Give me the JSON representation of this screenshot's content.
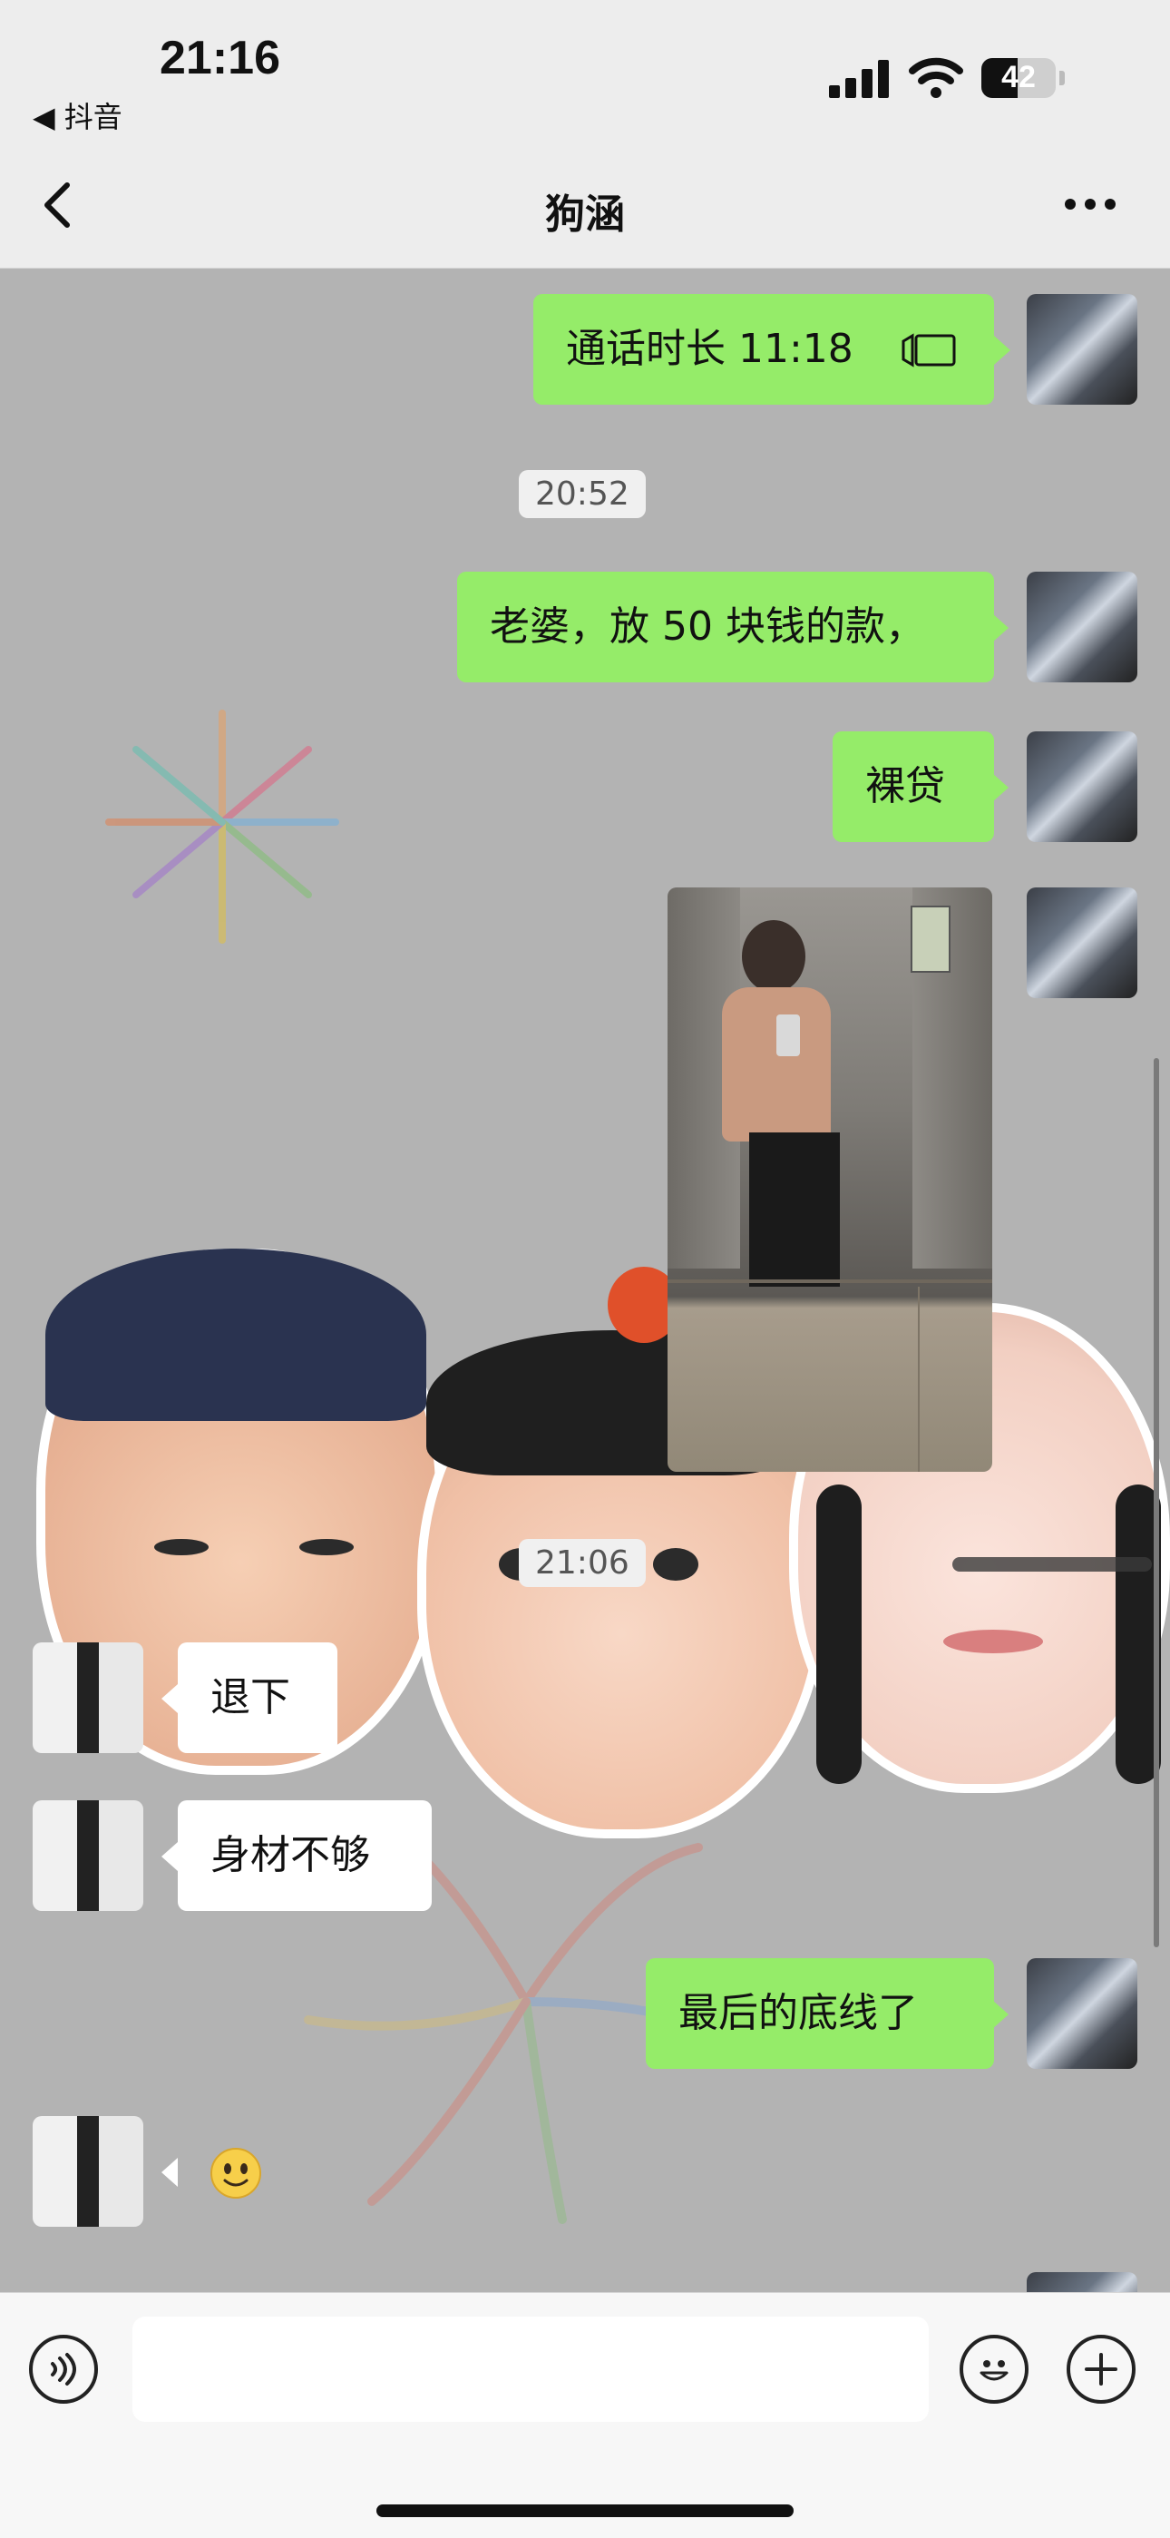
{
  "status_bar": {
    "time": "21:16",
    "back_app": "◀ 抖音",
    "battery": "42"
  },
  "header": {
    "title": "狗涵",
    "more": "···"
  },
  "messages": [
    {
      "type": "call",
      "side": "right",
      "text": "通话时长 11:18"
    },
    {
      "type": "timestamp",
      "text": "20:52"
    },
    {
      "type": "text",
      "side": "right",
      "text": "老婆，放 50 块钱的款，"
    },
    {
      "type": "text",
      "side": "right",
      "text": "裸贷"
    },
    {
      "type": "image",
      "side": "right"
    },
    {
      "type": "timestamp",
      "text": "21:06"
    },
    {
      "type": "text",
      "side": "left",
      "text": "退下"
    },
    {
      "type": "text",
      "side": "left",
      "text": "身材不够"
    },
    {
      "type": "text",
      "side": "right",
      "text": "最后的底线了"
    },
    {
      "type": "emoji",
      "side": "left",
      "text": "🙂"
    }
  ],
  "input": {
    "voice_icon": "voice-icon",
    "emoji_icon": "emoji-icon",
    "plus_icon": "plus-icon"
  },
  "colors": {
    "chat_bg": "#b3b3b3",
    "bubble_green": "#95ec69",
    "bubble_white": "#ffffff",
    "header_bg": "#ededed"
  }
}
